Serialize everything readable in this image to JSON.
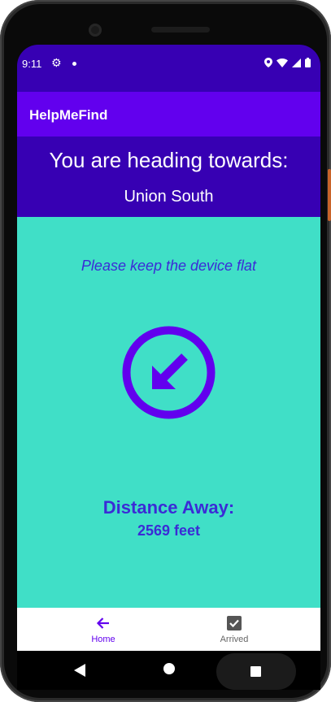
{
  "status_bar": {
    "time": "9:11",
    "icons": [
      "gear-icon",
      "dot-icon",
      "location-icon",
      "wifi-icon",
      "signal-icon",
      "battery-icon"
    ]
  },
  "app_bar": {
    "title": "HelpMeFind"
  },
  "header": {
    "title": "You are heading towards:",
    "destination": "Union South"
  },
  "main": {
    "hint": "Please keep the device flat",
    "compass_icon": "arrow-down-left-icon",
    "distance_label": "Distance Away:",
    "distance_value": "2569 feet"
  },
  "bottom_nav": {
    "items": [
      {
        "label": "Home",
        "icon": "arrow-left-icon",
        "selected": true
      },
      {
        "label": "Arrived",
        "icon": "checkbox-checked-icon",
        "selected": false
      }
    ]
  },
  "colors": {
    "status_bar": "#3700b3",
    "app_bar": "#6200ee",
    "content_bg": "#40dfc7",
    "accent_text": "#3b2bd6",
    "compass": "#6200ee"
  }
}
